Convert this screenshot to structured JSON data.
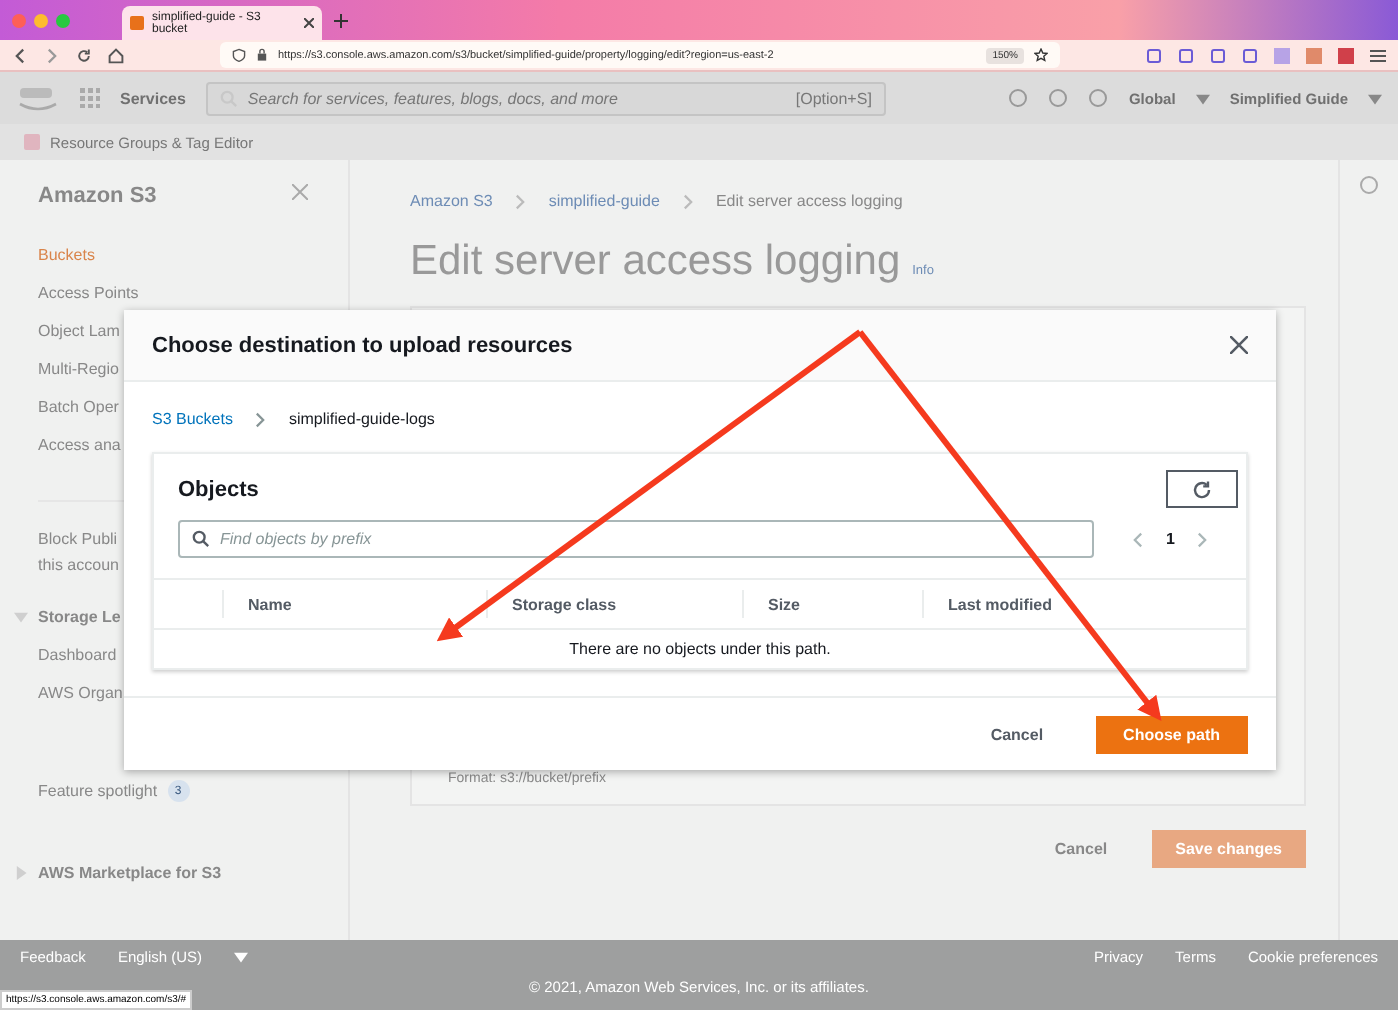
{
  "browser": {
    "tab_title": "simplified-guide - S3 bucket",
    "url": "https://s3.console.aws.amazon.com/s3/bucket/simplified-guide/property/logging/edit?region=us-east-2",
    "zoom": "150%",
    "status_url": "https://s3.console.aws.amazon.com/s3/#"
  },
  "top_nav": {
    "services": "Services",
    "search_placeholder": "Search for services, features, blogs, docs, and more",
    "shortcut": "[Option+S]",
    "region": "Global",
    "account": "Simplified Guide"
  },
  "favorites": [
    "Resource Groups & Tag Editor"
  ],
  "sidebar": {
    "title": "Amazon S3",
    "items": [
      {
        "kind": "link",
        "label": "Buckets",
        "selected": true
      },
      {
        "kind": "link",
        "label": "Access Points",
        "selected": false
      },
      {
        "kind": "link",
        "label": "Object Lam",
        "selected": false
      },
      {
        "kind": "link",
        "label": "Multi-Regio",
        "selected": false
      },
      {
        "kind": "link",
        "label": "Batch Oper",
        "selected": false
      },
      {
        "kind": "link",
        "label": "Access ana",
        "selected": false
      },
      {
        "kind": "note",
        "label": "Block Publi\nthis accoun"
      },
      {
        "kind": "section",
        "label": "Storage Le",
        "expanded": true,
        "children": [
          {
            "kind": "link",
            "label": "Dashboard",
            "selected": false
          },
          {
            "kind": "link",
            "label": "AWS Organ",
            "selected": false
          }
        ]
      },
      {
        "kind": "spotlight",
        "label": "Feature spotlight",
        "badge": "3"
      },
      {
        "kind": "section",
        "label": "AWS Marketplace for S3",
        "expanded": false
      }
    ]
  },
  "content": {
    "breadcrumbs": [
      "Amazon S3",
      "simplified-guide",
      "Edit server access logging"
    ],
    "title": "Edit server access logging",
    "info": "Info",
    "format_hint": "Format: s3://bucket/prefix",
    "cancel": "Cancel",
    "save": "Save changes"
  },
  "modal": {
    "title": "Choose destination to upload resources",
    "breadcrumbs": [
      {
        "kind": "link",
        "label": "S3 Buckets"
      },
      {
        "kind": "current",
        "label": "simplified-guide-logs"
      }
    ],
    "panel_title": "Objects",
    "search_placeholder": "Find objects by prefix",
    "page": "1",
    "columns": [
      "Name",
      "Storage class",
      "Size",
      "Last modified"
    ],
    "empty_message": "There are no objects under this path.",
    "cancel": "Cancel",
    "primary": "Choose path"
  },
  "footer": {
    "left": [
      "Feedback",
      "English (US)"
    ],
    "right": [
      "Privacy",
      "Terms",
      "Cookie preferences"
    ],
    "copyright": "© 2021, Amazon Web Services, Inc. or its affiliates."
  }
}
